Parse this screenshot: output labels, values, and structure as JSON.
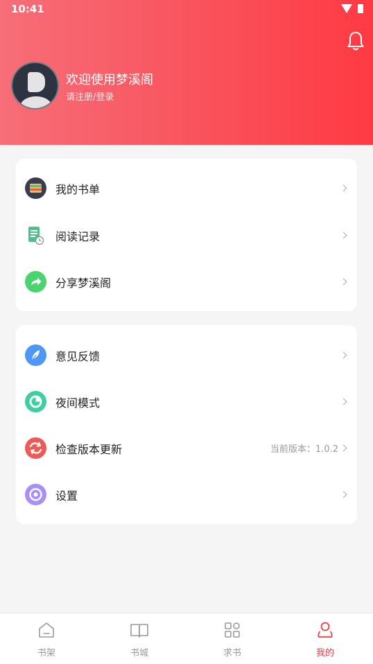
{
  "status_bar": {
    "time": "10:41"
  },
  "profile": {
    "welcome": "欢迎使用梦溪阁",
    "login_prompt": "请注册/登录"
  },
  "menu_group1": [
    {
      "label": "我的书单",
      "icon": "book-list-icon"
    },
    {
      "label": "阅读记录",
      "icon": "reading-record-icon"
    },
    {
      "label": "分享梦溪阁",
      "icon": "share-icon"
    }
  ],
  "menu_group2": [
    {
      "label": "意见反馈",
      "icon": "feedback-icon"
    },
    {
      "label": "夜间模式",
      "icon": "night-mode-icon"
    },
    {
      "label": "检查版本更新",
      "icon": "update-icon",
      "extra": "当前版本：1.0.2"
    },
    {
      "label": "设置",
      "icon": "settings-icon"
    }
  ],
  "tabs": [
    {
      "label": "书架",
      "icon": "bookshelf-icon",
      "active": false
    },
    {
      "label": "书城",
      "icon": "bookstore-icon",
      "active": false
    },
    {
      "label": "求书",
      "icon": "request-book-icon",
      "active": false
    },
    {
      "label": "我的",
      "icon": "profile-icon",
      "active": true
    }
  ],
  "colors": {
    "accent": "#f33a44",
    "header_start": "#f76e78",
    "header_end": "#ff3a43"
  }
}
